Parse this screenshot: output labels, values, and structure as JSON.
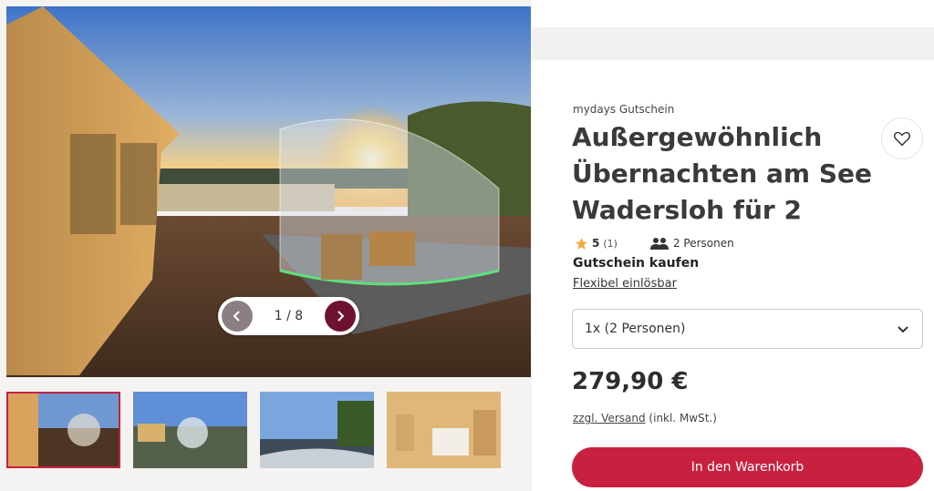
{
  "gallery": {
    "pager_text": "1 / 8",
    "prev_icon": "chevron-left-icon",
    "next_icon": "chevron-right-icon",
    "prev_color": "#8c7f82",
    "next_color": "#6e1233",
    "thumbnail_count": 4,
    "active_thumbnail": 1,
    "active_border_color": "#c8203f"
  },
  "product": {
    "eyebrow": "mydays Gutschein",
    "title_line1": "Außergewöhnlich",
    "title_line2": "Übernachten am See",
    "title_line3": "Wadersloh für 2",
    "rating": "5",
    "rating_count": "(1)",
    "persons": "2 Personen",
    "favorite_icon": "heart-icon",
    "star_icon": "star-icon",
    "persons_icon": "persons-icon"
  },
  "purchase": {
    "buy_label": "Gutschein kaufen",
    "flex_link": "Flexibel einlösbar",
    "select_value": "1x (2 Personen)",
    "price": "279,90 €",
    "shipping_link": "zzgl. Versand",
    "shipping_note": " (inkl. MwSt.)",
    "cart_button": "In den Warenkorb",
    "accent_color": "#c8203f"
  }
}
